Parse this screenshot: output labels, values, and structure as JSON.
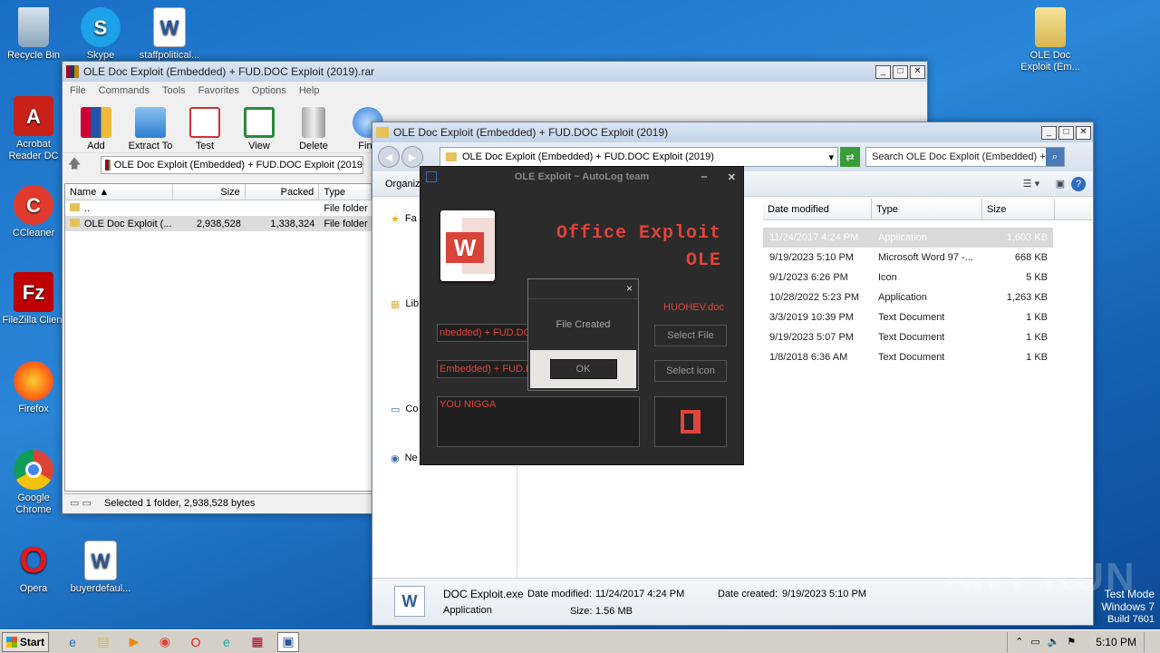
{
  "desktop": {
    "icons": [
      {
        "label": "Recycle Bin"
      },
      {
        "label": "Skype"
      },
      {
        "label": "staffpolitical..."
      },
      {
        "label": "Acrobat Reader DC"
      },
      {
        "label": "CCleaner"
      },
      {
        "label": "FileZilla Client"
      },
      {
        "label": "Firefox"
      },
      {
        "label": "Google Chrome"
      },
      {
        "label": "Opera"
      },
      {
        "label": "buyerdefaul..."
      },
      {
        "label": "OLE Doc Exploit (Em..."
      }
    ]
  },
  "winrar": {
    "title": "OLE Doc Exploit (Embedded) + FUD.DOC Exploit (2019).rar",
    "menu": [
      "File",
      "Commands",
      "Tools",
      "Favorites",
      "Options",
      "Help"
    ],
    "tools": [
      "Add",
      "Extract To",
      "Test",
      "View",
      "Delete",
      "Find"
    ],
    "path": "OLE Doc Exploit (Embedded) + FUD.DOC Exploit (2019",
    "columns": [
      "Name",
      "Size",
      "Packed",
      "Type"
    ],
    "rows": [
      {
        "name": "..",
        "size": "",
        "packed": "",
        "type": "File folder"
      },
      {
        "name": "OLE Doc Exploit (...",
        "size": "2,938,528",
        "packed": "1,338,324",
        "type": "File folder"
      }
    ],
    "status": "Selected 1 folder, 2,938,528 bytes"
  },
  "explorer": {
    "title": "OLE Doc Exploit (Embedded) + FUD.DOC Exploit (2019)",
    "address": "OLE Doc Exploit (Embedded) + FUD.DOC Exploit (2019)",
    "search_placeholder": "Search OLE Doc Exploit (Embedded) + ...",
    "organize": "Organiz",
    "nav": [
      "Fa",
      "Lib",
      "Co",
      "Ne"
    ],
    "columns": [
      "Date modified",
      "Type",
      "Size"
    ],
    "rows": [
      {
        "date": "11/24/2017 4:24 PM",
        "type": "Application",
        "size": "1,603 KB"
      },
      {
        "date": "9/19/2023 5:10 PM",
        "type": "Microsoft Word 97 -...",
        "size": "668 KB"
      },
      {
        "date": "9/1/2023 6:26 PM",
        "type": "Icon",
        "size": "5 KB"
      },
      {
        "date": "10/28/2022 5:23 PM",
        "type": "Application",
        "size": "1,263 KB"
      },
      {
        "date": "3/3/2019 10:39 PM",
        "type": "Text Document",
        "size": "1 KB"
      },
      {
        "date": "9/19/2023 5:07 PM",
        "type": "Text Document",
        "size": "1 KB"
      },
      {
        "date": "1/8/2018 6:36 AM",
        "type": "Text Document",
        "size": "1 KB"
      }
    ],
    "details": {
      "name": "DOC Exploit.exe",
      "kind": "Application",
      "modified_label": "Date modified:",
      "modified": "11/24/2017 4:24 PM",
      "size_label": "Size:",
      "size": "1.56 MB",
      "created_label": "Date created:",
      "created": "9/19/2023 5:10 PM"
    }
  },
  "exploit_app": {
    "title": "OLE Exploit ~ AutoLog team",
    "heading1": "Office Exploit",
    "heading2": "OLE",
    "filename": "HUOHEV.doc",
    "field1": "nbedded) + FUD.DO",
    "field2": "Embedded) + FUD.D",
    "text": "YOU NIGGA",
    "select_file": "Select File",
    "select_icon": "Select icon",
    "accent": "#e0443a"
  },
  "dialog": {
    "message": "File Created",
    "ok": "OK",
    "close": "×"
  },
  "taskbar": {
    "start": "Start",
    "clock": "5:10 PM",
    "watermark": "ANY RUN",
    "test_mode": [
      "Test Mode",
      "Windows 7",
      "Build 7601"
    ]
  }
}
